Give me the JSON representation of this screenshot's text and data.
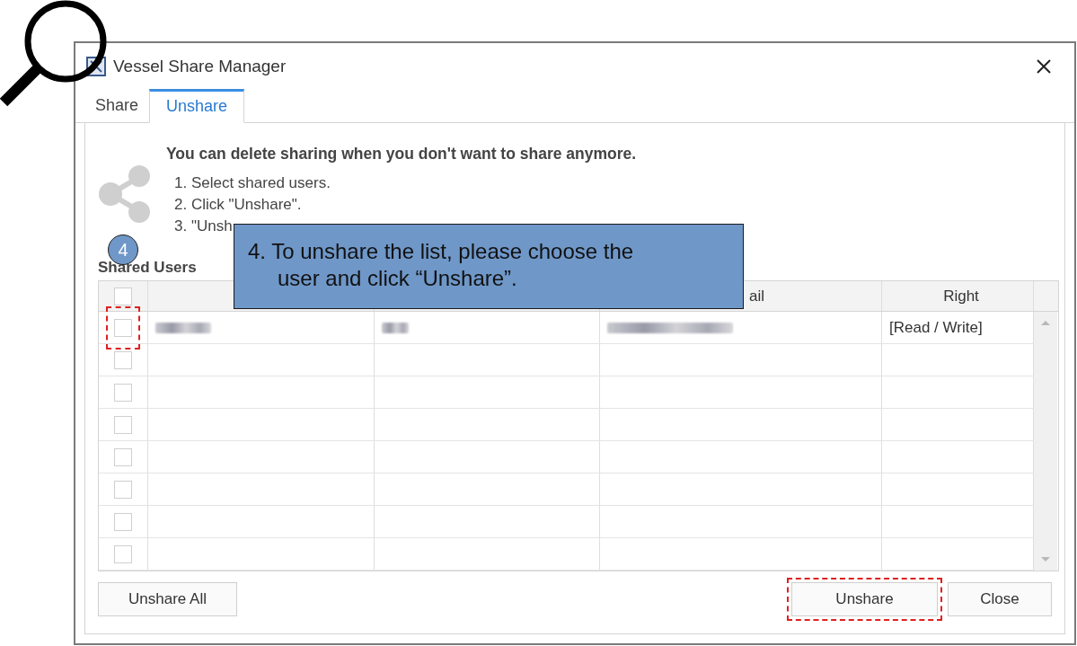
{
  "window": {
    "title": "Vessel Share Manager"
  },
  "tabs": [
    {
      "label": "Share",
      "selected": false
    },
    {
      "label": "Unshare",
      "selected": true
    }
  ],
  "intro": {
    "heading": "You can delete sharing when you don't want to share anymore.",
    "steps": [
      "1. Select shared users.",
      "2. Click \"Unshare\".",
      "3. \"Unsh"
    ]
  },
  "section_title": "Shared Users",
  "table": {
    "header": {
      "email": "ail",
      "right": "Right"
    },
    "header_checked": false,
    "rows": [
      {
        "checked": false,
        "highlighted": true,
        "id_redacted": true,
        "name_redacted": true,
        "email_redacted": true,
        "right": "[Read / Write]"
      },
      {
        "checked": false,
        "highlighted": false
      },
      {
        "checked": false,
        "highlighted": false
      },
      {
        "checked": false,
        "highlighted": false
      },
      {
        "checked": false,
        "highlighted": false
      },
      {
        "checked": false,
        "highlighted": false
      },
      {
        "checked": false,
        "highlighted": false
      },
      {
        "checked": false,
        "highlighted": false
      }
    ]
  },
  "left_buttons": [
    {
      "label": "Unshare All",
      "highlighted": false
    }
  ],
  "right_buttons": [
    {
      "label": "Unshare",
      "highlighted": true
    },
    {
      "label": "Close",
      "highlighted": false
    }
  ],
  "annotation": {
    "badge": "4",
    "callout": "4. To unshare the list, please choose the user and click “Unshare”."
  }
}
